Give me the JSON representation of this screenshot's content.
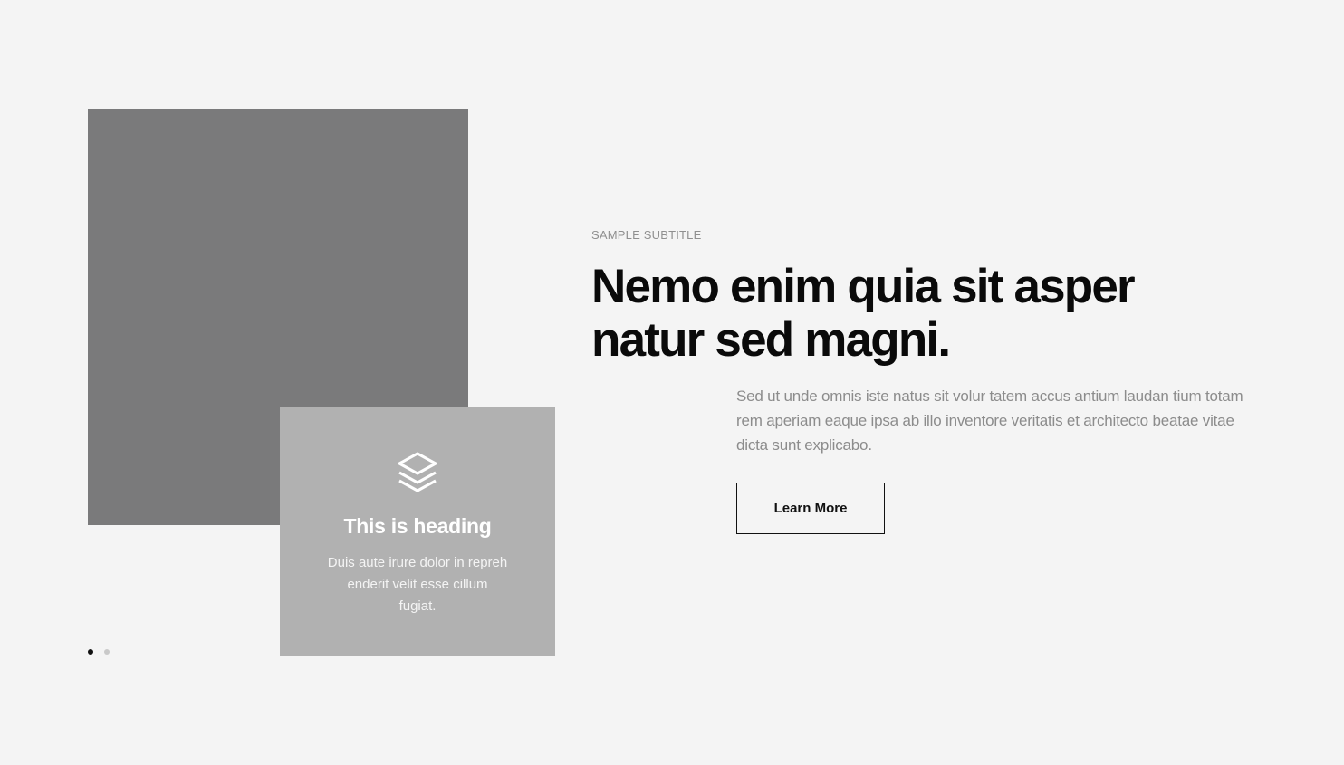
{
  "hero": {
    "subtitle": "SAMPLE SUBTITLE",
    "headline_line1": "Nemo enim quia sit asper",
    "headline_line2": "natur sed magni.",
    "body": "Sed ut unde omnis iste natus sit volur tatem accus antium laudan tium totam rem aperiam eaque ipsa ab illo inventore veritatis et architecto beatae vitae dicta sunt explicabo.",
    "cta_label": "Learn More"
  },
  "feature_card": {
    "icon": "layers-icon",
    "heading": "This is heading",
    "text": "Duis aute irure dolor in repreh enderit velit esse cillum fugiat."
  },
  "slider": {
    "total_slides": 2,
    "active_slide": 1
  },
  "colors": {
    "background": "#f4f4f4",
    "image_placeholder": "#7a7a7b",
    "card_background": "#b1b1b1",
    "headline": "#0a0a0a",
    "muted_text": "#8c8c8c"
  }
}
